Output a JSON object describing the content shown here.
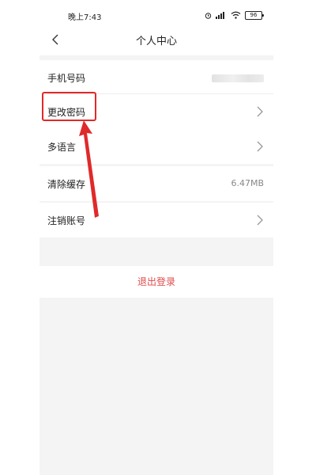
{
  "status_bar": {
    "time": "晚上7:43",
    "battery": "96",
    "icons": [
      "alarm-icon",
      "signal-icon",
      "wifi-icon",
      "battery-icon"
    ]
  },
  "header": {
    "title": "个人中心",
    "back_icon": "chevron-left-icon"
  },
  "settings": {
    "phone": {
      "label": "手机号码"
    },
    "change_password": {
      "label": "更改密码"
    },
    "language": {
      "label": "多语言"
    },
    "clear_cache": {
      "label": "清除缓存",
      "value": "6.47MB"
    },
    "delete_account": {
      "label": "注销账号"
    }
  },
  "logout": {
    "label": "退出登录"
  },
  "colors": {
    "highlight": "#e0292a",
    "logout_text": "#e04a4a",
    "background": "#f4f4f4"
  }
}
